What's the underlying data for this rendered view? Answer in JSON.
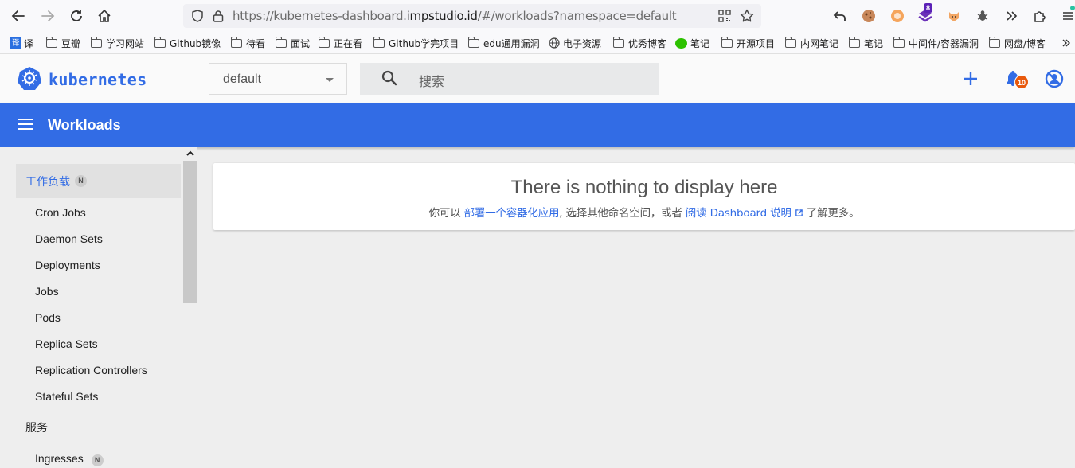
{
  "browser": {
    "url_prefix": "https://kubernetes-dashboard.",
    "url_host": "impstudio.id",
    "url_suffix": "/#/workloads?namespace=default",
    "extension_badge": "8"
  },
  "bookmarks": [
    {
      "label": "译",
      "icon": "translate-icon"
    },
    {
      "label": "豆瓣",
      "icon": "folder-icon"
    },
    {
      "label": "学习网站",
      "icon": "folder-icon"
    },
    {
      "label": "Github镜像",
      "icon": "folder-icon"
    },
    {
      "label": "待看",
      "icon": "folder-icon"
    },
    {
      "label": "面试",
      "icon": "folder-icon"
    },
    {
      "label": "正在看",
      "icon": "folder-icon"
    },
    {
      "label": "Github学完项目",
      "icon": "folder-icon"
    },
    {
      "label": "edu通用漏洞",
      "icon": "folder-icon"
    },
    {
      "label": "电子资源",
      "icon": "globe-icon"
    },
    {
      "label": "优秀博客",
      "icon": "folder-icon"
    },
    {
      "label": "笔记",
      "icon": "wechat-icon"
    },
    {
      "label": "开源项目",
      "icon": "folder-icon"
    },
    {
      "label": "内网笔记",
      "icon": "folder-icon"
    },
    {
      "label": "笔记",
      "icon": "folder-icon"
    },
    {
      "label": "中间件/容器漏洞",
      "icon": "folder-icon"
    },
    {
      "label": "网盘/博客",
      "icon": "folder-icon"
    }
  ],
  "header": {
    "logo_text": "kubernetes",
    "namespace": "default",
    "search_placeholder": "搜索",
    "notification_count": "10"
  },
  "toolbar": {
    "title": "Workloads"
  },
  "sidebar": {
    "sections": [
      {
        "label": "工作负载",
        "badge": "N"
      },
      {
        "label": "服务"
      }
    ],
    "workload_items": [
      "Cron Jobs",
      "Daemon Sets",
      "Deployments",
      "Jobs",
      "Pods",
      "Replica Sets",
      "Replication Controllers",
      "Stateful Sets"
    ],
    "service_items": [
      {
        "label": "Ingresses",
        "badge": "N"
      }
    ]
  },
  "main": {
    "empty_title": "There is nothing to display here",
    "empty_prefix": "你可以",
    "deploy_link": "部署一个容器化应用",
    "empty_middle": ", 选择其他命名空间，或者",
    "docs_link": "阅读 Dashboard 说明",
    "empty_suffix": "了解更多。"
  },
  "colors": {
    "brand": "#326ce5",
    "notification_badge": "#e8590c"
  }
}
